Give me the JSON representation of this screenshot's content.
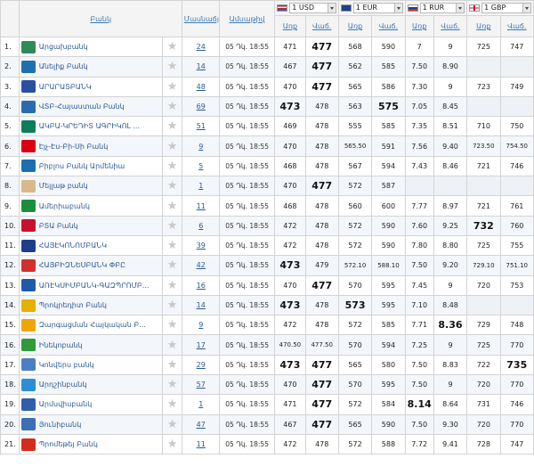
{
  "header": {
    "bank": "Բանկ",
    "branches": "Մասնաճյուղեր",
    "date": "Ամսաթիվ",
    "buy": "Առք",
    "sell": "Վաճ.",
    "currencies": [
      {
        "label": "1 USD",
        "flag_color": "#3c5aa6"
      },
      {
        "label": "1 EUR",
        "flag_color": "#1f3f8f"
      },
      {
        "label": "1 RUR",
        "flag_color": "#d52b1e"
      },
      {
        "label": "1 GBP",
        "flag_color": "#c8102e"
      }
    ]
  },
  "rows": [
    {
      "n": "1.",
      "bank": "Արցախբանկ",
      "logo": "#2e8b57",
      "branches": "24",
      "date": "05 Դկ. 18:55",
      "usd": [
        "471",
        "477"
      ],
      "eur": [
        "568",
        "590"
      ],
      "rur": [
        "7",
        "9"
      ],
      "gbp": [
        "725",
        "747"
      ],
      "best": [
        "usd_s"
      ]
    },
    {
      "n": "2.",
      "bank": "Անելիք Բանկ",
      "logo": "#1f6fb0",
      "branches": "14",
      "date": "05 Դկ. 18:55",
      "usd": [
        "467",
        "477"
      ],
      "eur": [
        "562",
        "585"
      ],
      "rur": [
        "7.50",
        "8.90"
      ],
      "gbp": [
        "",
        ""
      ],
      "best": [
        "usd_s"
      ]
    },
    {
      "n": "3.",
      "bank": "ԱՐԱՐԱՏԲԱՆԿ",
      "logo": "#2a4fa0",
      "branches": "48",
      "date": "05 Դկ. 18:55",
      "usd": [
        "470",
        "477"
      ],
      "eur": [
        "565",
        "586"
      ],
      "rur": [
        "7.30",
        "9"
      ],
      "gbp": [
        "723",
        "749"
      ],
      "best": [
        "usd_s"
      ]
    },
    {
      "n": "4.",
      "bank": "ՎՏԲ-Հայաստան Բանկ",
      "logo": "#2c6ab0",
      "branches": "69",
      "date": "05 Դկ. 18:55",
      "usd": [
        "473",
        "478"
      ],
      "eur": [
        "563",
        "575"
      ],
      "rur": [
        "7.05",
        "8.45"
      ],
      "gbp": [
        "",
        ""
      ],
      "best": [
        "usd_b",
        "eur_s"
      ]
    },
    {
      "n": "5.",
      "bank": "ԱԿԲԱ-ԿՐԵԴԻՏ ԱԳՐԻԿՈԼ ...",
      "logo": "#0a7f5a",
      "branches": "51",
      "date": "05 Դկ. 18:55",
      "usd": [
        "469",
        "478"
      ],
      "eur": [
        "555",
        "585"
      ],
      "rur": [
        "7.35",
        "8.51"
      ],
      "gbp": [
        "710",
        "750"
      ],
      "best": []
    },
    {
      "n": "6.",
      "bank": "Էյչ-Էս-Բի-Սի Բանկ",
      "logo": "#db0011",
      "branches": "9",
      "date": "05 Դկ. 18:55",
      "usd": [
        "470",
        "478"
      ],
      "eur": [
        "565.50",
        "591"
      ],
      "rur": [
        "7.56",
        "9.40"
      ],
      "gbp": [
        "723.50",
        "754.50"
      ],
      "best": [],
      "small": [
        "eur_b",
        "gbp_b",
        "gbp_s"
      ]
    },
    {
      "n": "7.",
      "bank": "Բիբլոս Բանկ Արմենիա",
      "logo": "#1b6fae",
      "branches": "5",
      "date": "05 Դկ. 18:55",
      "usd": [
        "468",
        "478"
      ],
      "eur": [
        "567",
        "594"
      ],
      "rur": [
        "7.43",
        "8.46"
      ],
      "gbp": [
        "721",
        "746"
      ],
      "best": []
    },
    {
      "n": "8.",
      "bank": "Մելլաթ բանկ",
      "logo": "#d9b98c",
      "branches": "1",
      "date": "05 Դկ. 18:55",
      "usd": [
        "470",
        "477"
      ],
      "eur": [
        "572",
        "587"
      ],
      "rur": [
        "",
        ""
      ],
      "gbp": [
        "",
        ""
      ],
      "best": [
        "usd_s"
      ]
    },
    {
      "n": "9.",
      "bank": "Ամերիաբանկ",
      "logo": "#1a8f3c",
      "branches": "11",
      "date": "05 Դկ. 18:55",
      "usd": [
        "468",
        "478"
      ],
      "eur": [
        "560",
        "600"
      ],
      "rur": [
        "7.77",
        "8.97"
      ],
      "gbp": [
        "721",
        "761"
      ],
      "best": []
    },
    {
      "n": "10.",
      "bank": "ԲՏԱ Բանկ",
      "logo": "#c8102e",
      "branches": "6",
      "date": "05 Դկ. 18:55",
      "usd": [
        "472",
        "478"
      ],
      "eur": [
        "572",
        "590"
      ],
      "rur": [
        "7.60",
        "9.25"
      ],
      "gbp": [
        "732",
        "760"
      ],
      "best": [
        "gbp_b"
      ]
    },
    {
      "n": "11.",
      "bank": "ՀԱՅԷԿՈՆՈՄԲԱՆԿ",
      "logo": "#1d3f8a",
      "branches": "39",
      "date": "05 Դկ. 18:55",
      "usd": [
        "472",
        "478"
      ],
      "eur": [
        "572",
        "590"
      ],
      "rur": [
        "7.80",
        "8.80"
      ],
      "gbp": [
        "725",
        "755"
      ],
      "best": []
    },
    {
      "n": "12.",
      "bank": "ՀԱՅԲԻԶՆԵՍԲԱՆԿ ՓԲԸ",
      "logo": "#d0312d",
      "branches": "42",
      "date": "05 Դկ. 18:55",
      "usd": [
        "473",
        "479"
      ],
      "eur": [
        "572.10",
        "588.10"
      ],
      "rur": [
        "7.50",
        "9.20"
      ],
      "gbp": [
        "729.10",
        "751.10"
      ],
      "best": [
        "usd_b"
      ],
      "small": [
        "eur_b",
        "eur_s",
        "gbp_b",
        "gbp_s"
      ]
    },
    {
      "n": "13.",
      "bank": "ԱՌԷԿՍԻՄԲԱՆԿ-ԳԱԶՊՐՈՄԲ...",
      "logo": "#1e5aa8",
      "branches": "16",
      "date": "05 Դկ. 18:55",
      "usd": [
        "470",
        "477"
      ],
      "eur": [
        "570",
        "595"
      ],
      "rur": [
        "7.45",
        "9"
      ],
      "gbp": [
        "720",
        "753"
      ],
      "best": [
        "usd_s"
      ]
    },
    {
      "n": "14.",
      "bank": "Պրոկրեդիտ Բանկ",
      "logo": "#e5b000",
      "branches": "14",
      "date": "05 Դկ. 18:55",
      "usd": [
        "473",
        "478"
      ],
      "eur": [
        "573",
        "595"
      ],
      "rur": [
        "7.10",
        "8.48"
      ],
      "gbp": [
        "",
        ""
      ],
      "best": [
        "usd_b",
        "eur_b"
      ]
    },
    {
      "n": "15.",
      "bank": "Զարգացման Հայկական Բ...",
      "logo": "#f0a500",
      "branches": "9",
      "date": "05 Դկ. 18:55",
      "usd": [
        "472",
        "478"
      ],
      "eur": [
        "572",
        "585"
      ],
      "rur": [
        "7.71",
        "8.36"
      ],
      "gbp": [
        "729",
        "748"
      ],
      "best": [
        "rur_s"
      ]
    },
    {
      "n": "16.",
      "bank": "Ինեկոբանկ",
      "logo": "#2e9b3a",
      "branches": "17",
      "date": "05 Դկ. 18:55",
      "usd": [
        "470.50",
        "477.50"
      ],
      "eur": [
        "570",
        "594"
      ],
      "rur": [
        "7.25",
        "9"
      ],
      "gbp": [
        "725",
        "770"
      ],
      "best": [],
      "small": [
        "usd_b",
        "usd_s"
      ]
    },
    {
      "n": "17.",
      "bank": "Կոնվերս բանկ",
      "logo": "#4a7fc4",
      "branches": "29",
      "date": "05 Դկ. 18:55",
      "usd": [
        "473",
        "477"
      ],
      "eur": [
        "565",
        "580"
      ],
      "rur": [
        "7.50",
        "8.83"
      ],
      "gbp": [
        "722",
        "735"
      ],
      "best": [
        "usd_b",
        "usd_s",
        "gbp_s"
      ]
    },
    {
      "n": "18.",
      "bank": "Արդշինբանկ",
      "logo": "#2a8fd4",
      "branches": "57",
      "date": "05 Դկ. 18:55",
      "usd": [
        "470",
        "477"
      ],
      "eur": [
        "570",
        "595"
      ],
      "rur": [
        "7.50",
        "9"
      ],
      "gbp": [
        "720",
        "770"
      ],
      "best": [
        "usd_s"
      ]
    },
    {
      "n": "19.",
      "bank": "Արմսվիսբանկ",
      "logo": "#2f5fa8",
      "branches": "1",
      "date": "05 Դկ. 18:55",
      "usd": [
        "471",
        "477"
      ],
      "eur": [
        "572",
        "584"
      ],
      "rur": [
        "8.14",
        "8.64"
      ],
      "gbp": [
        "731",
        "746"
      ],
      "best": [
        "usd_s",
        "rur_b"
      ]
    },
    {
      "n": "20.",
      "bank": "Յունիբանկ",
      "logo": "#3c6fb4",
      "branches": "47",
      "date": "05 Դկ. 18:55",
      "usd": [
        "467",
        "477"
      ],
      "eur": [
        "565",
        "590"
      ],
      "rur": [
        "7.50",
        "9.30"
      ],
      "gbp": [
        "720",
        "770"
      ],
      "best": [
        "usd_s"
      ]
    },
    {
      "n": "21.",
      "bank": "Պրոմեթեյ Բանկ",
      "logo": "#d52b1e",
      "branches": "11",
      "date": "05 Դկ. 18:55",
      "usd": [
        "472",
        "478"
      ],
      "eur": [
        "572",
        "588"
      ],
      "rur": [
        "7.72",
        "9.41"
      ],
      "gbp": [
        "728",
        "747"
      ],
      "best": []
    }
  ]
}
